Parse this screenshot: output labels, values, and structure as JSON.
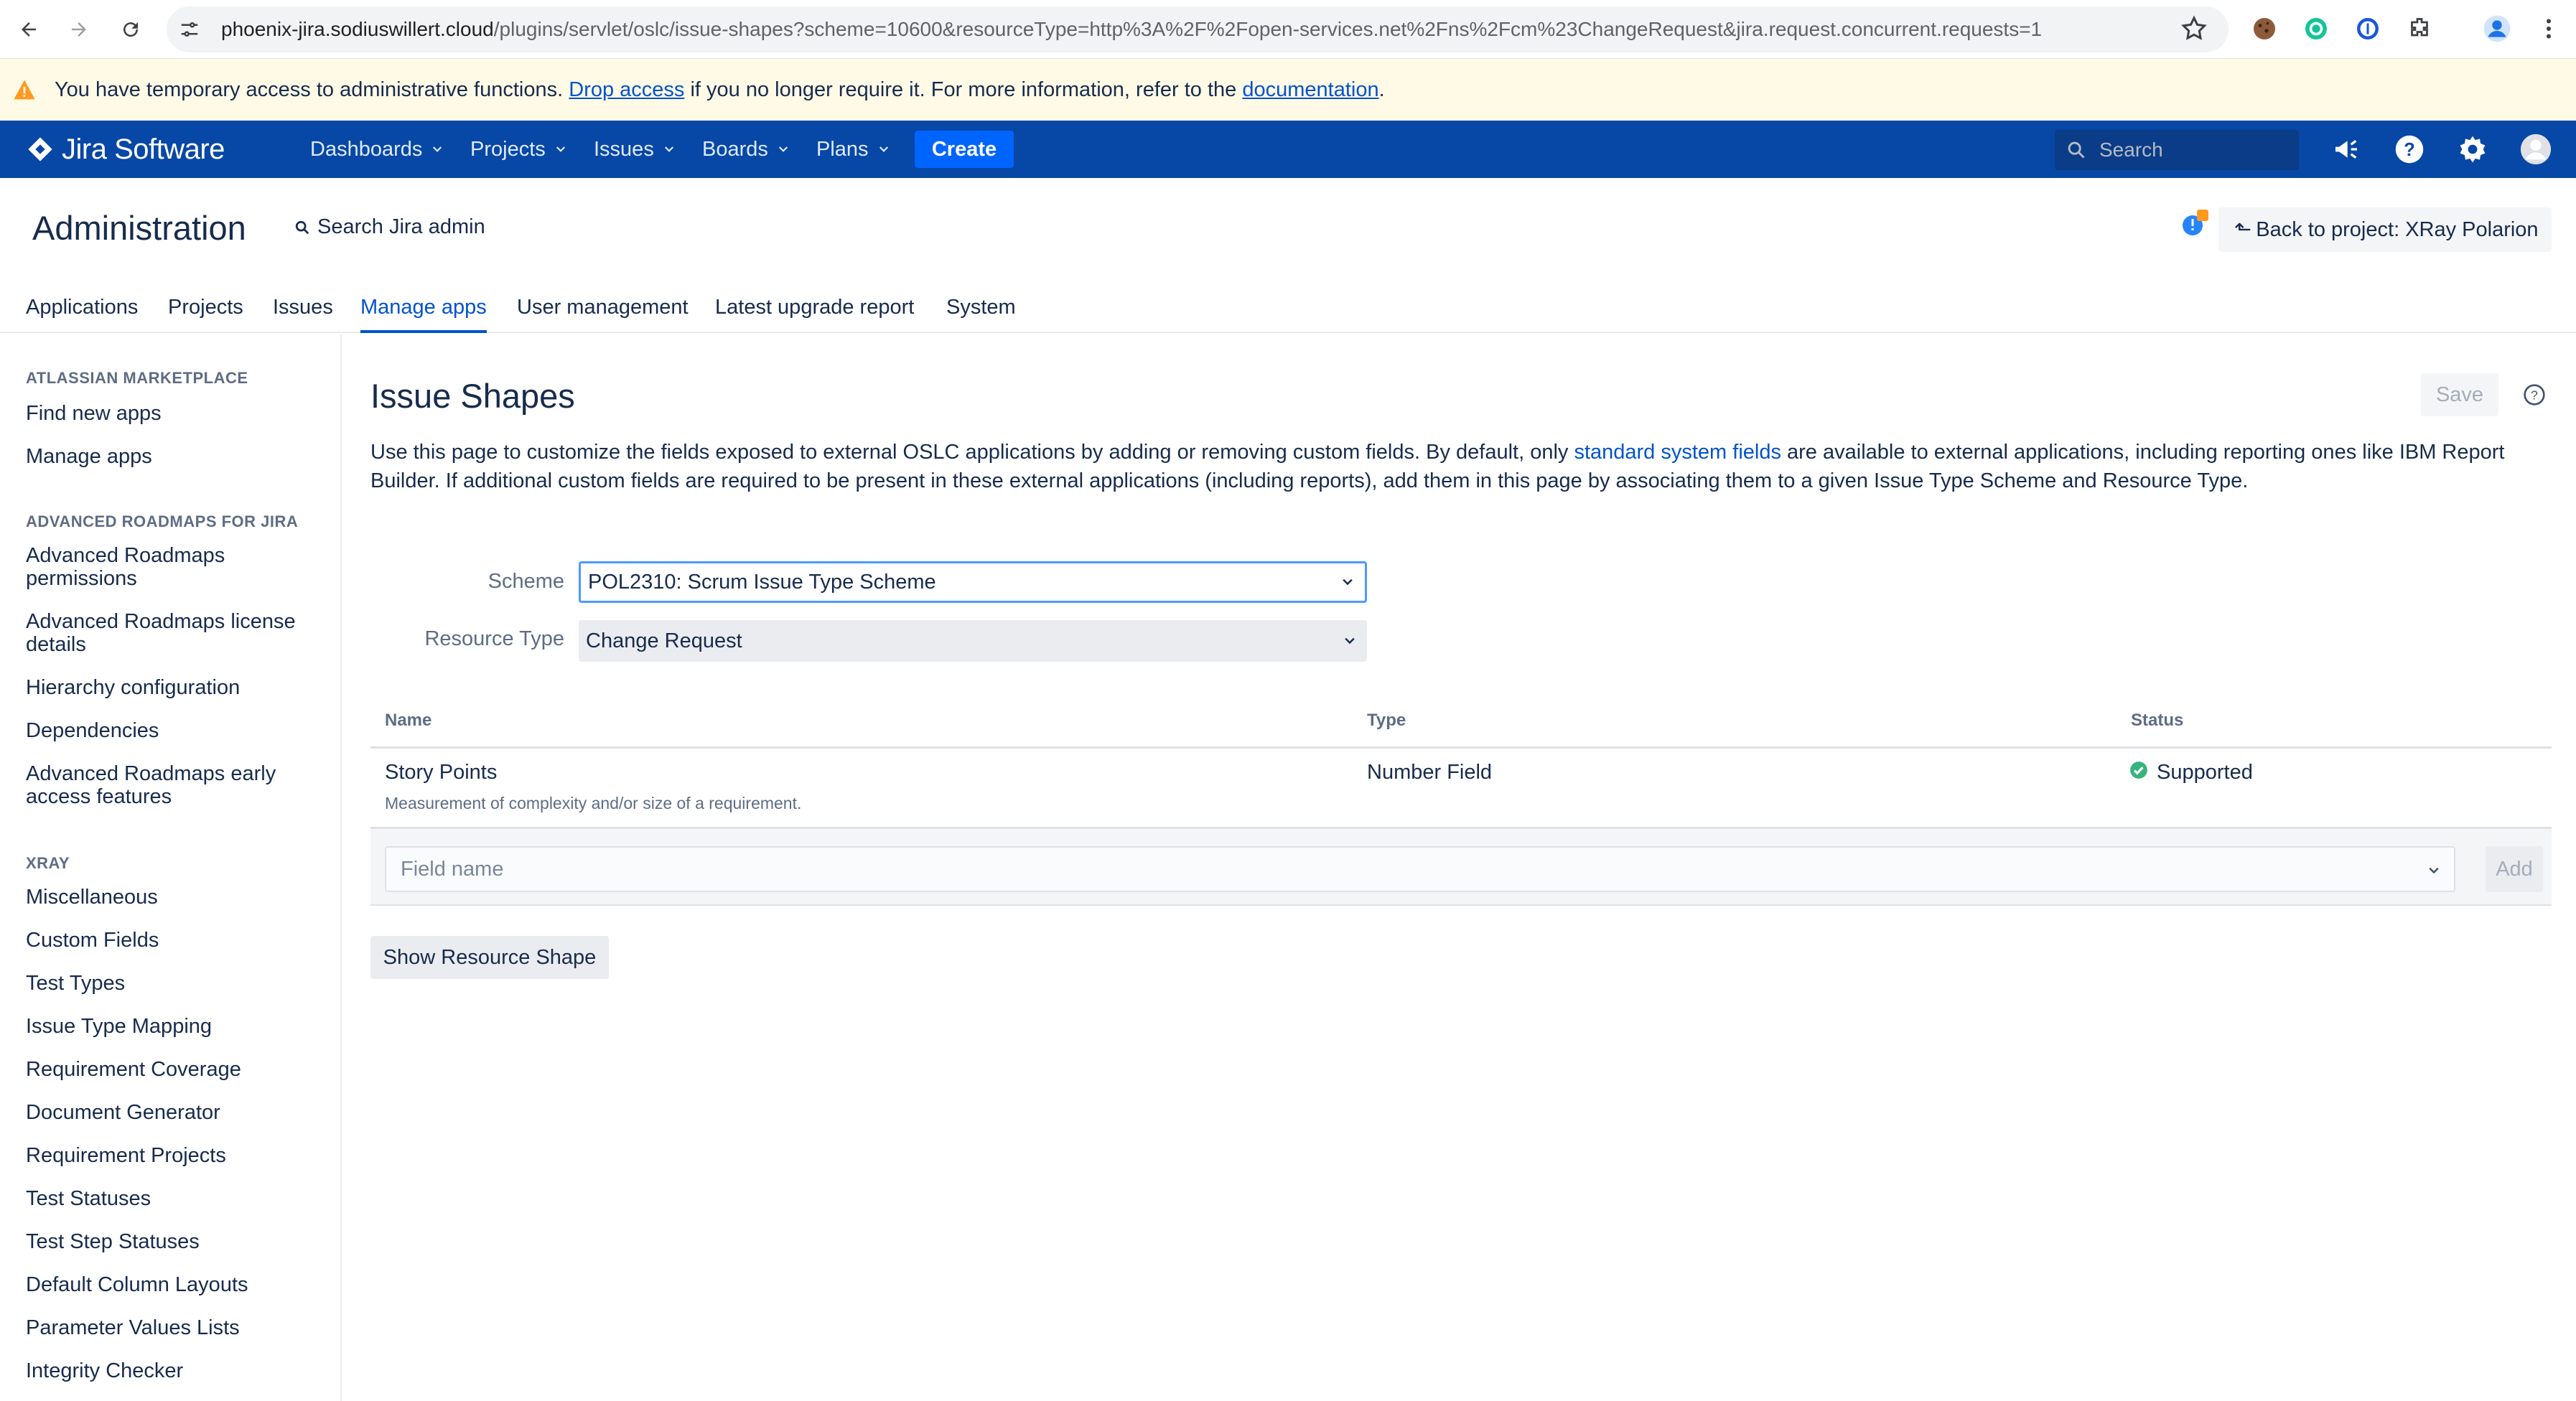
{
  "browser": {
    "url_host": "phoenix-jira.sodiuswillert.cloud",
    "url_path": "/plugins/servlet/oslc/issue-shapes?scheme=10600&resourceType=http%3A%2F%2Fopen-services.net%2Fns%2Fcm%23ChangeRequest&jira.request.concurrent.requests=1"
  },
  "banner": {
    "text_before": "You have temporary access to administrative functions. ",
    "drop_link": "Drop access",
    "text_middle": " if you no longer require it. For more information, refer to the ",
    "doc_link": "documentation",
    "text_after": "."
  },
  "topnav": {
    "logo": "Jira Software",
    "menus": [
      "Dashboards",
      "Projects",
      "Issues",
      "Boards",
      "Plans"
    ],
    "create": "Create",
    "search_placeholder": "Search"
  },
  "admin": {
    "title": "Administration",
    "search": "Search Jira admin",
    "back_button": "Back to project: XRay Polarion",
    "tabs": [
      "Applications",
      "Projects",
      "Issues",
      "Manage apps",
      "User management",
      "Latest upgrade report",
      "System"
    ],
    "active_tab": "Manage apps"
  },
  "sidebar": {
    "sections": [
      {
        "title": "ATLASSIAN MARKETPLACE",
        "items": [
          "Find new apps",
          "Manage apps"
        ]
      },
      {
        "title": "ADVANCED ROADMAPS FOR JIRA",
        "items": [
          "Advanced Roadmaps permissions",
          "Advanced Roadmaps license details",
          "Hierarchy configuration",
          "Dependencies",
          "Advanced Roadmaps early access features"
        ]
      },
      {
        "title": "XRAY",
        "items": [
          "Miscellaneous",
          "Custom Fields",
          "Test Types",
          "Issue Type Mapping",
          "Requirement Coverage",
          "Document Generator",
          "Requirement Projects",
          "Test Statuses",
          "Test Step Statuses",
          "Default Column Layouts",
          "Parameter Values Lists",
          "Integrity Checker"
        ]
      }
    ]
  },
  "main": {
    "title": "Issue Shapes",
    "save": "Save",
    "desc_part1": "Use this page to customize the fields exposed to external OSLC applications by adding or removing custom fields. By default, only ",
    "desc_link": "standard system fields",
    "desc_part2": " are available to external applications, including reporting ones like IBM Report Builder. If additional custom fields are required to be present in these external applications (including reports), add them in this page by associating them to a given Issue Type Scheme and Resource Type.",
    "scheme_label": "Scheme",
    "scheme_value": "POL2310: Scrum Issue Type Scheme",
    "resource_label": "Resource Type",
    "resource_value": "Change Request",
    "table": {
      "headers": [
        "Name",
        "Type",
        "Status"
      ],
      "rows": [
        {
          "name": "Story Points",
          "description": "Measurement of complexity and/or size of a requirement.",
          "type": "Number Field",
          "status": "Supported"
        }
      ]
    },
    "field_placeholder": "Field name",
    "add": "Add",
    "show_shape": "Show Resource Shape"
  },
  "colors": {
    "nav_bg": "#0747a6",
    "create_bg": "#0065ff",
    "link": "#0052cc",
    "banner_bg": "#fffae6",
    "status_ok": "#36b37e"
  }
}
